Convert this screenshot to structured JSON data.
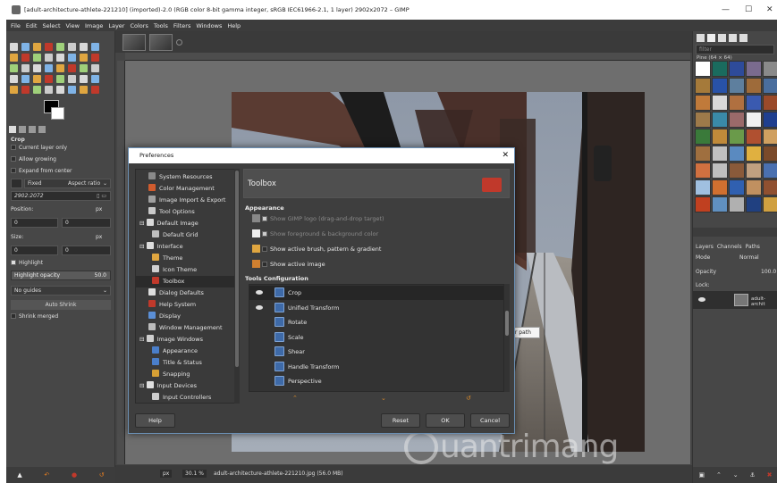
{
  "window": {
    "title": "[adult-architecture-athlete-221210] (imported)-2.0 (RGB color 8-bit gamma integer, sRGB IEC61966-2.1, 1 layer) 2902x2072 – GIMP",
    "controls": [
      "—",
      "☐",
      "✕"
    ]
  },
  "menubar": {
    "items": [
      "File",
      "Edit",
      "Select",
      "View",
      "Image",
      "Layer",
      "Colors",
      "Tools",
      "Filters",
      "Windows",
      "Help"
    ]
  },
  "tool_options": {
    "title": "Crop",
    "current_layer_only": "Current layer only",
    "allow_growing": "Allow growing",
    "expand_from_center": "Expand from center",
    "fixed": "Fixed",
    "aspect_ratio": "Aspect ratio",
    "ratio_value": "2902:2072",
    "position_label": "Position:",
    "position_unit": "px",
    "position_x": "0",
    "position_y": "0",
    "size_label": "Size:",
    "size_unit": "px",
    "size_w": "0",
    "size_h": "0",
    "highlight": "Highlight",
    "highlight_opacity_label": "Highlight opacity",
    "highlight_opacity_value": "50.0",
    "guides": "No guides",
    "auto_shrink": "Auto Shrink",
    "shrink_merged": "Shrink merged"
  },
  "statusbar": {
    "unit": "px",
    "zoom": "30.1 %",
    "filename": "adult-architecture-athlete-221210.jpg (56.0 MB)"
  },
  "right_dock": {
    "filter_placeholder": "filter",
    "pattern_label": "Pine (64 × 64)",
    "tabs": [
      "Layers",
      "Channels",
      "Paths"
    ],
    "mode_label": "Mode",
    "mode_value": "Normal",
    "opacity_label": "Opacity",
    "opacity_value": "100.0",
    "lock_label": "Lock:",
    "layer_name": "adult-archit"
  },
  "preferences": {
    "title": "Preferences",
    "tree": [
      {
        "label": "System Resources",
        "color": "#8a8a8a"
      },
      {
        "label": "Color Management",
        "color": "#d15c2e"
      },
      {
        "label": "Image Import & Export",
        "color": "#a0a0a0"
      },
      {
        "label": "Tool Options",
        "color": "#c9c9c9"
      },
      {
        "label": "Default Image",
        "color": "#d9d9d9"
      },
      {
        "label": "Default Grid",
        "color": "#bdbdbd"
      },
      {
        "label": "Interface",
        "color": "#dcdcdc"
      },
      {
        "label": "Theme",
        "color": "#e0a640"
      },
      {
        "label": "Icon Theme",
        "color": "#d0d0d0"
      },
      {
        "label": "Toolbox",
        "color": "#c0392b"
      },
      {
        "label": "Dialog Defaults",
        "color": "#dddddd"
      },
      {
        "label": "Help System",
        "color": "#c0392b"
      },
      {
        "label": "Display",
        "color": "#5b8fd6"
      },
      {
        "label": "Window Management",
        "color": "#bbbbbb"
      },
      {
        "label": "Image Windows",
        "color": "#cfcfcf"
      },
      {
        "label": "Appearance",
        "color": "#4a7ec9"
      },
      {
        "label": "Title & Status",
        "color": "#4a7ec9"
      },
      {
        "label": "Snapping",
        "color": "#d6a035"
      },
      {
        "label": "Input Devices",
        "color": "#e0e0e0"
      },
      {
        "label": "Input Controllers",
        "color": "#cfcfcf"
      }
    ],
    "panel_title": "Toolbox",
    "appearance_heading": "Appearance",
    "appearance_options": [
      {
        "label": "Show GIMP logo (drag-and-drop target)",
        "dim": true
      },
      {
        "label": "Show foreground & background color",
        "dim": true
      },
      {
        "label": "Show active brush, pattern & gradient",
        "dim": false
      },
      {
        "label": "Show active image",
        "dim": false
      }
    ],
    "tools_heading": "Tools Configuration",
    "tools": [
      {
        "label": "Crop",
        "visible": true,
        "selected": true
      },
      {
        "label": "Unified Transform",
        "visible": true,
        "selected": false
      },
      {
        "label": "Rotate",
        "visible": false,
        "selected": false
      },
      {
        "label": "Scale",
        "visible": false,
        "selected": false
      },
      {
        "label": "Shear",
        "visible": false,
        "selected": false
      },
      {
        "label": "Handle Transform",
        "visible": false,
        "selected": false
      },
      {
        "label": "Perspective",
        "visible": false,
        "selected": false
      }
    ],
    "arrows": [
      "⌃",
      "⌄",
      "↺"
    ],
    "buttons": {
      "help": "Help",
      "reset": "Reset",
      "ok": "OK",
      "cancel": "Cancel"
    }
  },
  "tooltip": "Rotate Tool: Rotate the layer, selection or path",
  "watermark": "uantrimang"
}
